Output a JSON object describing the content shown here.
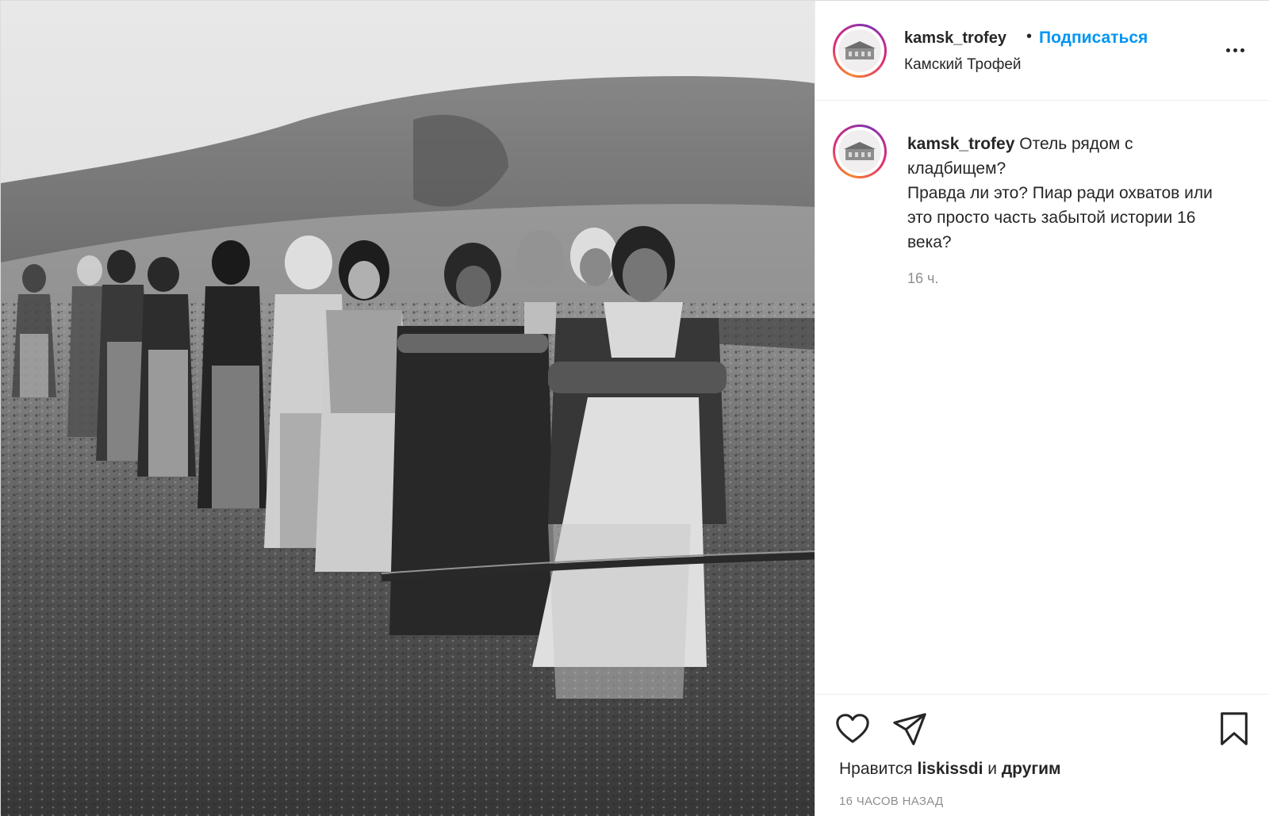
{
  "post": {
    "username": "kamsk_trofey",
    "separator": "•",
    "follow_label": "Подписаться",
    "location": "Камский Трофей",
    "more_icon": "more-dots-icon"
  },
  "caption": {
    "username": "kamsk_trofey",
    "line1": "Отель рядом с кладбищем?",
    "line2": "Правда ли это? Пиар ради охватов или это просто часть забытой истории 16 века?",
    "time": "16 ч."
  },
  "actions": {
    "like_icon": "heart-icon",
    "share_icon": "paper-plane-icon",
    "save_icon": "bookmark-icon"
  },
  "likes": {
    "prefix": "Нравится",
    "user": "liskissdi",
    "conjunction": "и",
    "others": "другим"
  },
  "posted_ago": "16 ЧАСОВ НАЗАД",
  "colors": {
    "link": "#0095f6",
    "text": "#262626",
    "muted": "#8e8e8e",
    "border": "#efefef"
  }
}
